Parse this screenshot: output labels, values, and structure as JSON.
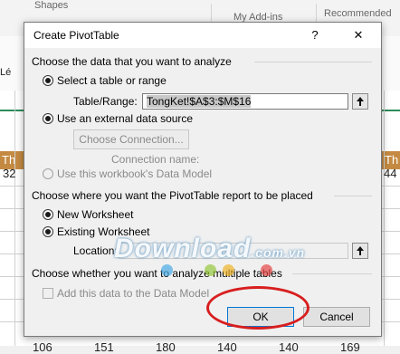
{
  "background": {
    "ribbon": {
      "shapes": "Shapes",
      "addins": "My Add-ins",
      "recommended": "Recommended"
    },
    "left_stub": "Lé",
    "header_left": "Th",
    "header_right": "Th",
    "row_left": "32",
    "row_right": "44",
    "bottom_values": [
      "106",
      "151",
      "180",
      "140",
      "140",
      "169"
    ]
  },
  "dialog": {
    "title": "Create PivotTable",
    "help": "?",
    "close": "✕",
    "section1": "Choose the data that you want to analyze",
    "opt_select_table": "Select a table or range",
    "table_range_label": "Table/Range:",
    "table_range_value": "TongKet!$A$3:$M$16",
    "opt_external": "Use an external data source",
    "choose_connection": "Choose Connection...",
    "connection_name": "Connection name:",
    "opt_data_model": "Use this workbook's Data Model",
    "section2": "Choose where you want the PivotTable report to be placed",
    "opt_new_ws": "New Worksheet",
    "opt_existing_ws": "Existing Worksheet",
    "location_label": "Location:",
    "location_value": "",
    "section3": "Choose whether you want to analyze multiple tables",
    "add_data_model": "Add this data to the Data Model",
    "ok": "OK",
    "cancel": "Cancel"
  },
  "watermark": {
    "text": "Download",
    "suffix": ".com.vn"
  },
  "colors": {
    "annotation": "#d81e1e",
    "header_bar": "#c48a42",
    "accent": "#0078d7"
  }
}
